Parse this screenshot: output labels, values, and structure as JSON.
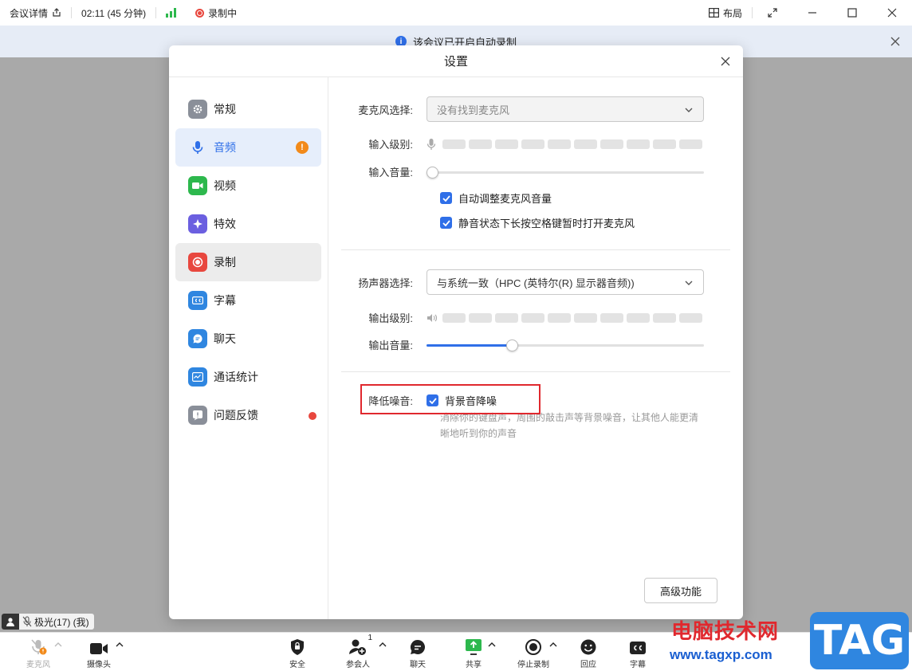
{
  "titlebar": {
    "meeting_info": "会议详情",
    "timer": "02:11 (45 分钟)",
    "recording": "录制中",
    "layout": "布局"
  },
  "banner": {
    "text": "该会议已开启自动录制"
  },
  "dialog": {
    "title": "设置",
    "nav": [
      {
        "label": "常规",
        "icon": "gear-icon",
        "color": "#8a8f99"
      },
      {
        "label": "音频",
        "icon": "microphone-icon",
        "color": "#2f6fe8",
        "badge": "!"
      },
      {
        "label": "视频",
        "icon": "video-icon",
        "color": "#2db84d"
      },
      {
        "label": "特效",
        "icon": "sparkle-icon",
        "color": "#6b5fe0"
      },
      {
        "label": "录制",
        "icon": "record-icon",
        "color": "#e8473e"
      },
      {
        "label": "字幕",
        "icon": "cc-icon",
        "color": "#2f86e0"
      },
      {
        "label": "聊天",
        "icon": "chat-icon",
        "color": "#2f86e0"
      },
      {
        "label": "通话统计",
        "icon": "stats-icon",
        "color": "#2f86e0"
      },
      {
        "label": "问题反馈",
        "icon": "feedback-icon",
        "color": "#8a8f99"
      }
    ],
    "audio": {
      "mic_label": "麦克风选择:",
      "mic_value": "没有找到麦克风",
      "input_level_label": "输入级别:",
      "input_volume_label": "输入音量:",
      "input_volume": 0,
      "auto_adjust": "自动调整麦克风音量",
      "push_to_talk": "静音状态下长按空格键暂时打开麦克风",
      "speaker_label": "扬声器选择:",
      "speaker_value": "与系统一致（HPC (英特尔(R) 显示器音频))",
      "output_level_label": "输出级别:",
      "output_volume_label": "输出音量:",
      "output_volume": 0.3,
      "noise_label": "降低噪音:",
      "noise_option": "背景音降噪",
      "noise_hint_1": "消除你的键盘声，周围的敲击声等背景噪音，让其他人能更清",
      "noise_hint_2": "晰地听到你的声音",
      "advanced": "高级功能"
    }
  },
  "participant": {
    "name": "极光(17) (我)"
  },
  "toolbar": {
    "mic": "麦克风",
    "camera": "摄像头",
    "security": "安全",
    "participants": "参会人",
    "participants_count": "1",
    "chat": "聊天",
    "share": "共享",
    "stop_record": "停止录制",
    "react": "回应",
    "subtitle": "字幕"
  },
  "watermark": {
    "site_cn": "电脑技术网",
    "url": "www.tagxp.com",
    "tag": "TAG"
  }
}
